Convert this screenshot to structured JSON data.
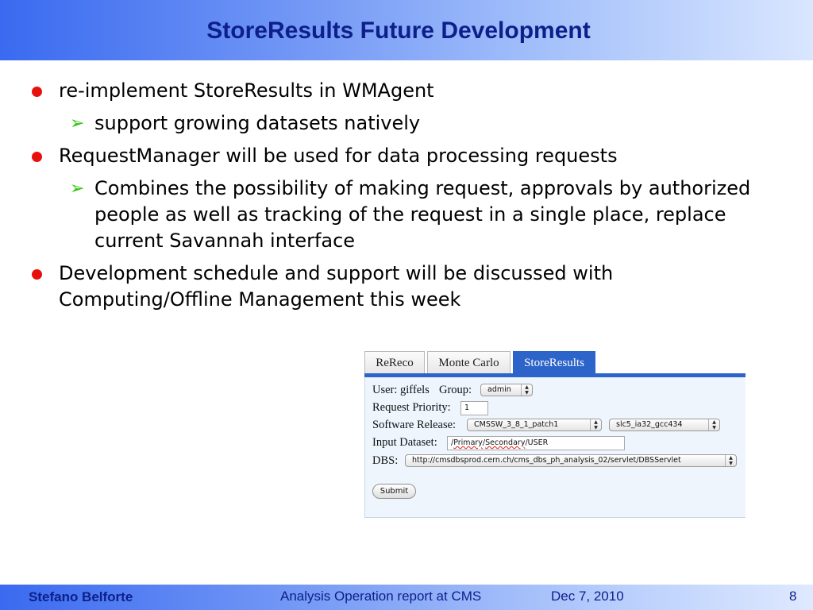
{
  "slide": {
    "title": "StoreResults Future Development"
  },
  "bullets": [
    {
      "text": "re-implement StoreResults in WMAgent",
      "subs": [
        "support growing datasets natively"
      ]
    },
    {
      "text": "RequestManager will be used for data processing requests",
      "subs": [
        "Combines the possibility of making request, approvals by authorized people as well as tracking of the request in a single place, replace current Savannah interface"
      ]
    },
    {
      "text": "Development schedule and support will be discussed with Computing/Offline Management this week",
      "subs": []
    }
  ],
  "webform": {
    "tabs": [
      {
        "label": "ReReco",
        "active": false
      },
      {
        "label": "Monte Carlo",
        "active": false
      },
      {
        "label": "StoreResults",
        "active": true
      }
    ],
    "user_label": "User: giffels",
    "group_label": "Group:",
    "group_value": "admin",
    "priority_label": "Request Priority:",
    "priority_value": "1",
    "software_label": "Software Release:",
    "release_value": "CMSSW_3_8_1_patch1",
    "arch_value": "slc5_ia32_gcc434",
    "dataset_label": "Input Dataset:",
    "dataset_prefix": "/",
    "dataset_primary": "Primary",
    "dataset_sep": "/",
    "dataset_secondary": "Secondary",
    "dataset_suffix": "/USER",
    "dbs_label": "DBS:",
    "dbs_value": "http://cmsdbsprod.cern.ch/cms_dbs_ph_analysis_02/servlet/DBSServlet",
    "submit_label": "Submit"
  },
  "footer": {
    "author": "Stefano Belforte",
    "event": "Analysis Operation report at CMS",
    "date": "Dec 7, 2010",
    "page": "8"
  },
  "colors": {
    "title_text": "#0d1f8a",
    "bullet_dot": "#e8100c",
    "sub_arrow": "#2fc40c",
    "active_tab": "#2c64c9"
  }
}
